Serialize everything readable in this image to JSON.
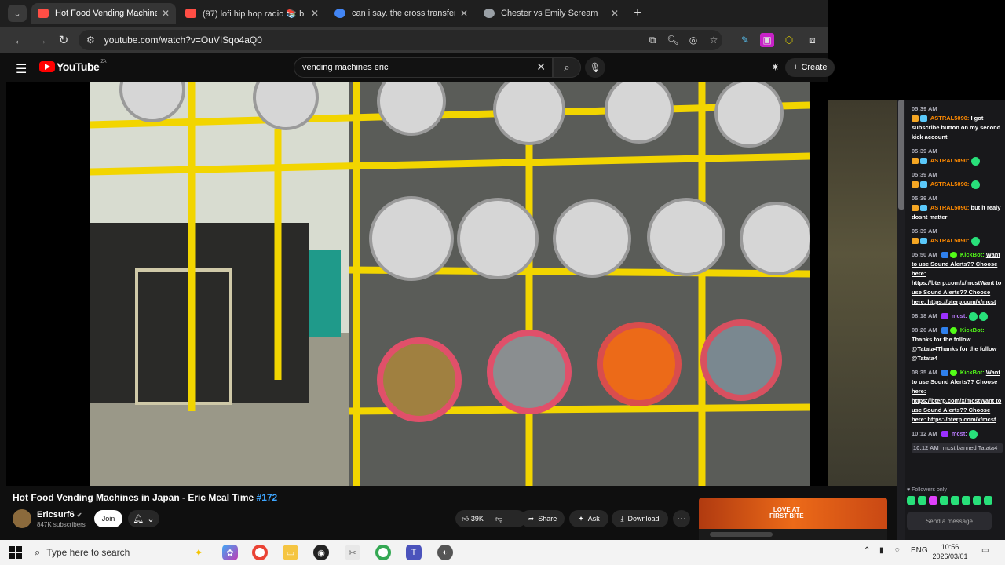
{
  "browser": {
    "tabs": [
      {
        "title": "Hot Food Vending Machine",
        "fav_color": "#ff4e45",
        "active": true
      },
      {
        "title": "(97) lofi hip hop radio 📚 b",
        "fav_color": "#ff4e45",
        "active": false
      },
      {
        "title": "can i say. the cross transference",
        "fav_color": "#4285f4",
        "active": false
      },
      {
        "title": "Chester vs Emily Scream",
        "fav_color": "#9aa0a6",
        "active": false
      }
    ],
    "url": "youtube.com/watch?v=OuVISqo4aQ0"
  },
  "youtube": {
    "logo_text": "YouTube",
    "country_code": "ZA",
    "search_query": "vending machines eric",
    "create_label": "Create"
  },
  "video": {
    "title": "Hot Food Vending Machines in Japan - Eric Meal Time",
    "hashtag": "#172",
    "channel_name": "Ericsurf6",
    "subscribers": "847K subscribers",
    "join_label": "Join",
    "like_count": "39K",
    "share_label": "Share",
    "ask_label": "Ask",
    "download_label": "Download"
  },
  "ad": {
    "line1": "LOVE AT",
    "line2": "FIRST BITE"
  },
  "chat": {
    "messages": [
      {
        "time": "05:39 AM",
        "user": "ASTRAL5090:",
        "text": "I got subscribe button on my second kick account",
        "user_class": "user-orange"
      },
      {
        "time": "05:39 AM",
        "user": "ASTRAL5090:",
        "text": "",
        "user_class": "user-orange"
      },
      {
        "time": "05:39 AM",
        "user": "ASTRAL5090:",
        "text": "",
        "user_class": "user-orange"
      },
      {
        "time": "05:39 AM",
        "user": "ASTRAL5090:",
        "text": "but it realy dosnt matter",
        "user_class": "user-orange"
      },
      {
        "time": "05:39 AM",
        "user": "ASTRAL5090:",
        "text": "",
        "user_class": "user-orange"
      },
      {
        "time": "05:50 AM",
        "user": "KickBot:",
        "text": "Want to use Sound Alerts?? Choose here: https://bterp.com/x/mcstWant to use Sound Alerts?? Choose here: https://bterp.com/x/mcst",
        "user_class": "user-green"
      },
      {
        "time": "08:18 AM",
        "user": "mcst:",
        "text": "",
        "user_class": "user-purple"
      },
      {
        "time": "08:26 AM",
        "user": "KickBot:",
        "text": "Thanks for the follow @Tatata4Thanks for the follow @Tatata4",
        "user_class": "user-green"
      },
      {
        "time": "08:35 AM",
        "user": "KickBot:",
        "text": "Want to use Sound Alerts?? Choose here: https://bterp.com/x/mcstWant to use Sound Alerts?? Choose here: https://bterp.com/x/mcst",
        "user_class": "user-green"
      },
      {
        "time": "10:12 AM",
        "user": "mcst:",
        "text": "",
        "user_class": "user-purple"
      }
    ],
    "ban_time": "10:12 AM",
    "ban_text": "mcst banned Tatata4",
    "followers_only": "Followers only",
    "send_placeholder": "Send a message"
  },
  "taskbar": {
    "search_placeholder": "Type here to search",
    "language": "ENG",
    "time": "10:56",
    "date": "2026/03/01"
  }
}
